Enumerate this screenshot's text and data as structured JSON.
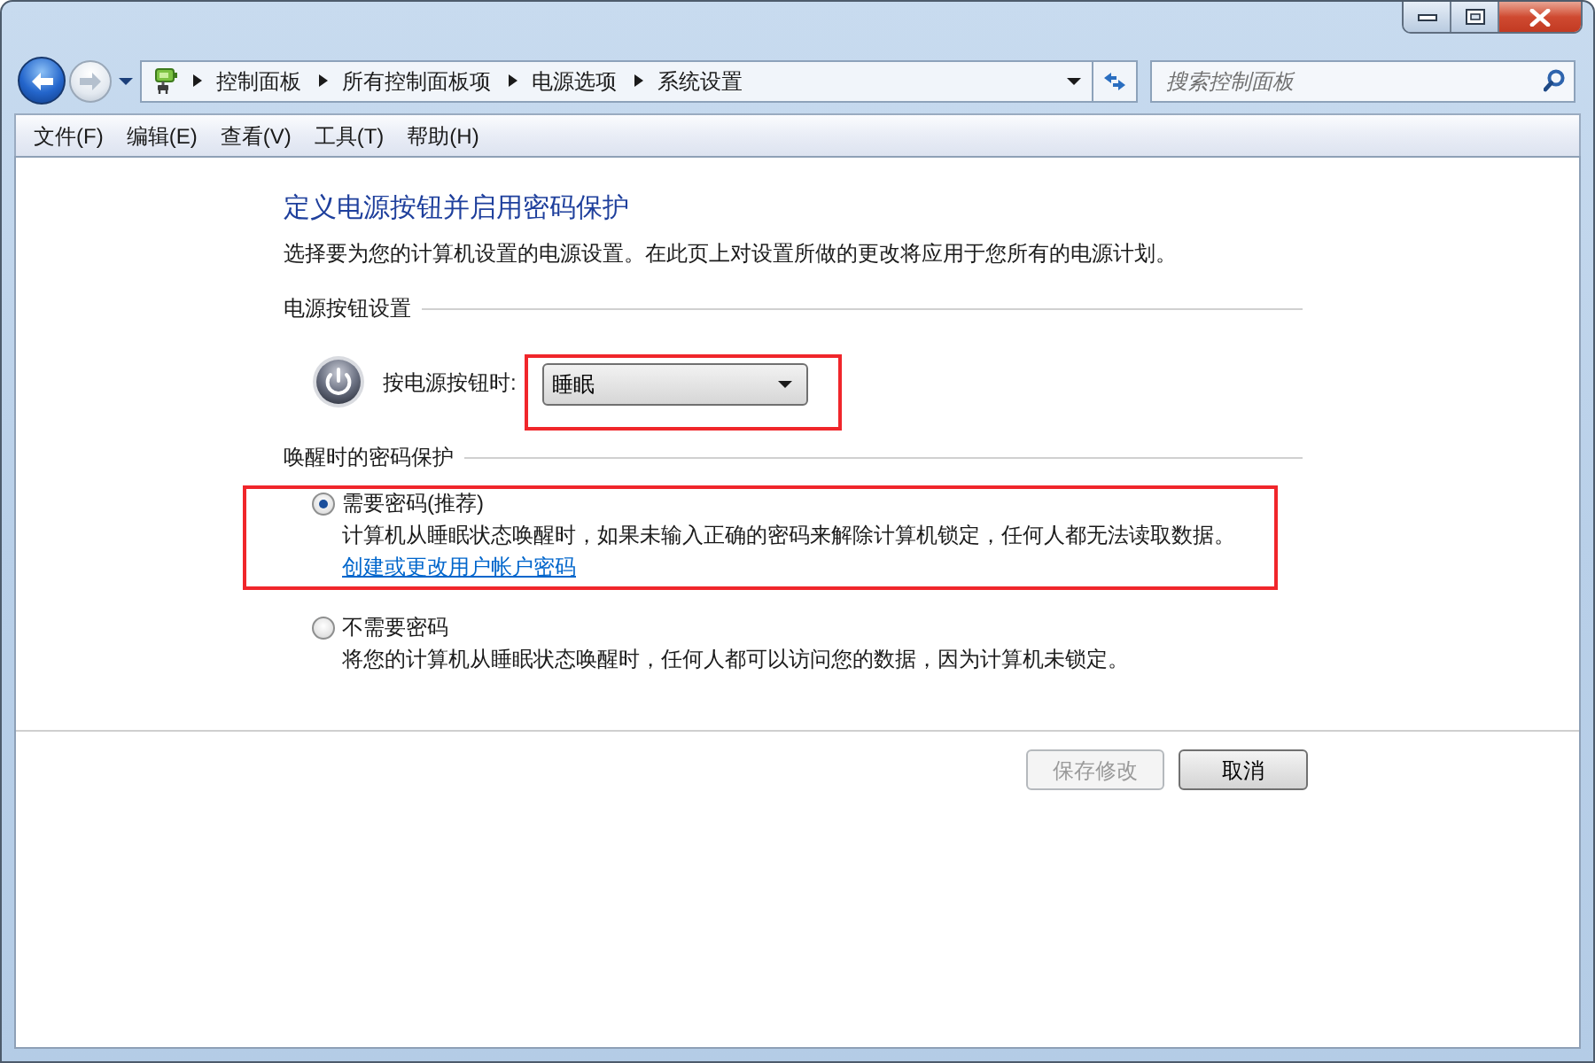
{
  "navigation": {
    "back": {
      "disabled": false
    },
    "forward": {
      "disabled": true
    },
    "breadcrumbs": [
      "控制面板",
      "所有控制面板项",
      "电源选项",
      "系统设置"
    ],
    "search": {
      "placeholder": "搜索控制面板"
    }
  },
  "menu_bar": [
    "文件(F)",
    "编辑(E)",
    "查看(V)",
    "工具(T)",
    "帮助(H)"
  ],
  "page": {
    "title": "定义电源按钮并启用密码保护",
    "description": "选择要为您的计算机设置的电源设置。在此页上对设置所做的更改将应用于您所有的电源计划。",
    "sections": [
      {
        "heading": "电源按钮设置",
        "kind": "dropdown",
        "label": "按电源按钮时:",
        "value": "睡眠",
        "highlighted": true
      },
      {
        "heading": "唤醒时的密码保护",
        "kind": "radio",
        "options": [
          {
            "label": "需要密码(推荐)",
            "description": "计算机从睡眠状态唤醒时，如果未输入正确的密码来解除计算机锁定，任何人都无法读取数据。",
            "link": "创建或更改用户帐户密码",
            "selected": true,
            "highlighted": true
          },
          {
            "label": "不需要密码",
            "description": "将您的计算机从睡眠状态唤醒时，任何人都可以访问您的数据，因为计算机未锁定。",
            "selected": false,
            "highlighted": false
          }
        ]
      }
    ]
  },
  "buttons": [
    {
      "label": "保存修改",
      "disabled": true
    },
    {
      "label": "取消",
      "disabled": false
    }
  ]
}
